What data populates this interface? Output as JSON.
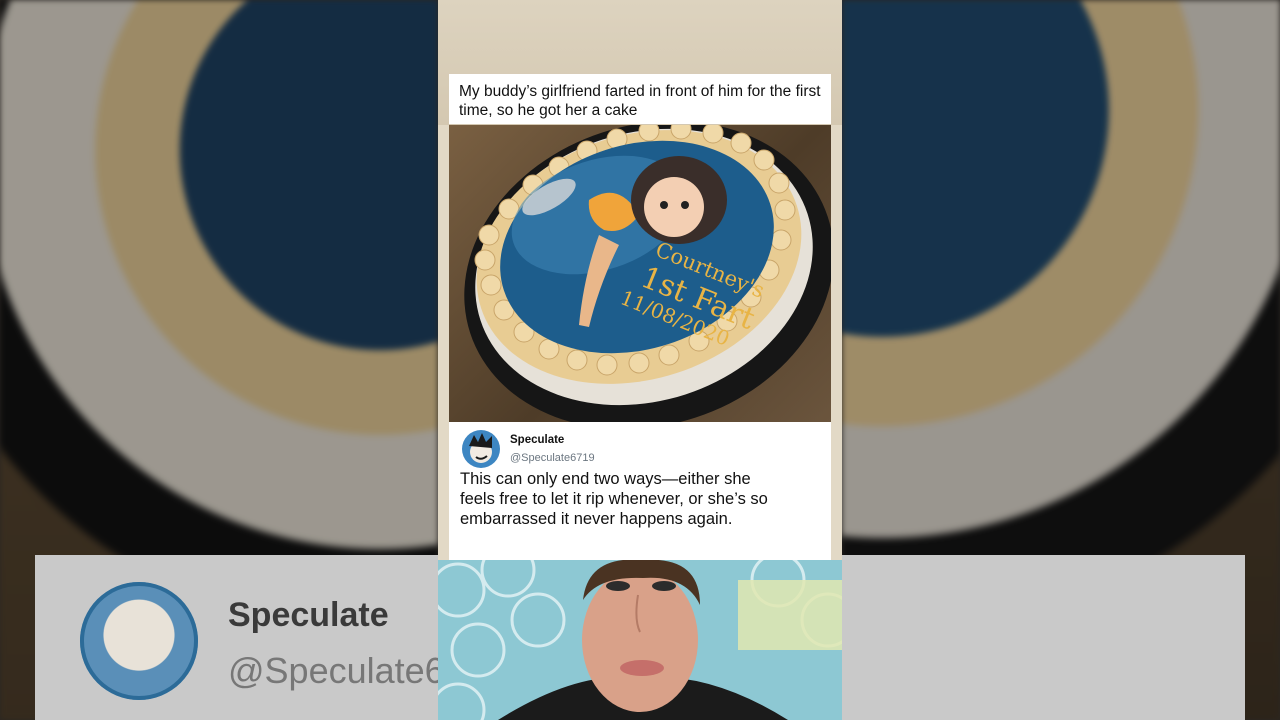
{
  "post": {
    "caption": "My buddy’s girlfriend farted in front of him for the first time, so he got her a cake"
  },
  "cake": {
    "line1": "Courtney's",
    "line2": "1st Fart",
    "date": "11/08/2020"
  },
  "tweet": {
    "name": "Speculate",
    "handle": "@Speculate6719",
    "text": "This can only end two ways—either she feels free to let it rip whenever, or she’s so embarrassed it never happens again."
  },
  "background": {
    "name": "Speculate",
    "handle": "@Speculate6"
  },
  "colors": {
    "frosting": "#e8cc93",
    "cake_blue": "#1d5d8c",
    "card_white": "#ffffff",
    "handle_gray": "#6b7680"
  }
}
